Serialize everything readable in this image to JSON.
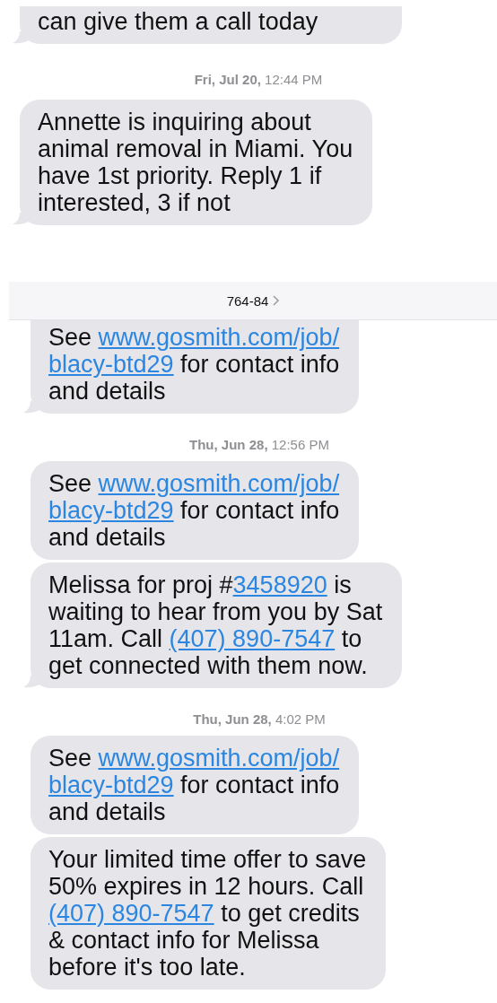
{
  "threads": [
    {
      "items": [
        {
          "kind": "bubble",
          "cut_top": true,
          "tail": true,
          "lines": [
            [
              {
                "text": "can give them a call today",
                "link": false
              }
            ]
          ]
        },
        {
          "kind": "timestamp",
          "text": "**Fri, Jul 20,** 12:44 PM"
        },
        {
          "kind": "bubble",
          "cut_top": false,
          "tail": true,
          "lines": [
            [
              {
                "text": "Annette is inquiring about",
                "link": false
              }
            ],
            [
              {
                "text": "animal removal in Miami. You",
                "link": false
              }
            ],
            [
              {
                "text": "have 1st priority. Reply 1 if",
                "link": false
              }
            ],
            [
              {
                "text": "interested, 3 if not",
                "link": false
              }
            ]
          ]
        }
      ]
    },
    {
      "header": {
        "title": "764-84"
      },
      "items": [
        {
          "kind": "bubble",
          "cut_top": true,
          "tail": true,
          "lines": [
            [
              {
                "text": "See ",
                "link": false
              },
              {
                "text": "www.gosmith.com/job/",
                "link": true
              }
            ],
            [
              {
                "text": "blacy-btd29",
                "link": true
              },
              {
                "text": " for contact info",
                "link": false
              }
            ],
            [
              {
                "text": "and details",
                "link": false
              }
            ]
          ]
        },
        {
          "kind": "timestamp",
          "text": "**Thu, Jun 28,** 12:56 PM"
        },
        {
          "kind": "bubble",
          "cut_top": false,
          "tail": false,
          "lines": [
            [
              {
                "text": "See ",
                "link": false
              },
              {
                "text": "www.gosmith.com/job/",
                "link": true
              }
            ],
            [
              {
                "text": "blacy-btd29",
                "link": true
              },
              {
                "text": " for contact info",
                "link": false
              }
            ],
            [
              {
                "text": "and details",
                "link": false
              }
            ]
          ]
        },
        {
          "kind": "bubble",
          "cut_top": false,
          "tail": true,
          "lines": [
            [
              {
                "text": "Melissa for proj #",
                "link": false
              },
              {
                "text": "3458920",
                "link": true
              },
              {
                "text": " is",
                "link": false
              }
            ],
            [
              {
                "text": "waiting to hear from you by Sat",
                "link": false
              }
            ],
            [
              {
                "text": "11am. Call ",
                "link": false
              },
              {
                "text": "(407) 890-7547",
                "link": true
              },
              {
                "text": " to",
                "link": false
              }
            ],
            [
              {
                "text": "get connected with them now.",
                "link": false
              }
            ]
          ]
        },
        {
          "kind": "timestamp",
          "text": "**Thu, Jun 28,** 4:02 PM"
        },
        {
          "kind": "bubble",
          "cut_top": false,
          "tail": false,
          "lines": [
            [
              {
                "text": "See ",
                "link": false
              },
              {
                "text": "www.gosmith.com/job/",
                "link": true
              }
            ],
            [
              {
                "text": "blacy-btd29",
                "link": true
              },
              {
                "text": " for contact info",
                "link": false
              }
            ],
            [
              {
                "text": "and details",
                "link": false
              }
            ]
          ]
        },
        {
          "kind": "bubble",
          "cut_top": false,
          "tail": false,
          "lines": [
            [
              {
                "text": "Your limited time offer to save",
                "link": false
              }
            ],
            [
              {
                "text": "50% expires in 12 hours. Call",
                "link": false
              }
            ],
            [
              {
                "text": "(407) 890-7547",
                "link": true
              },
              {
                "text": " to get credits",
                "link": false
              }
            ],
            [
              {
                "text": "& contact info for Melissa",
                "link": false
              }
            ],
            [
              {
                "text": "before it's too late.",
                "link": false
              }
            ]
          ]
        }
      ]
    }
  ]
}
